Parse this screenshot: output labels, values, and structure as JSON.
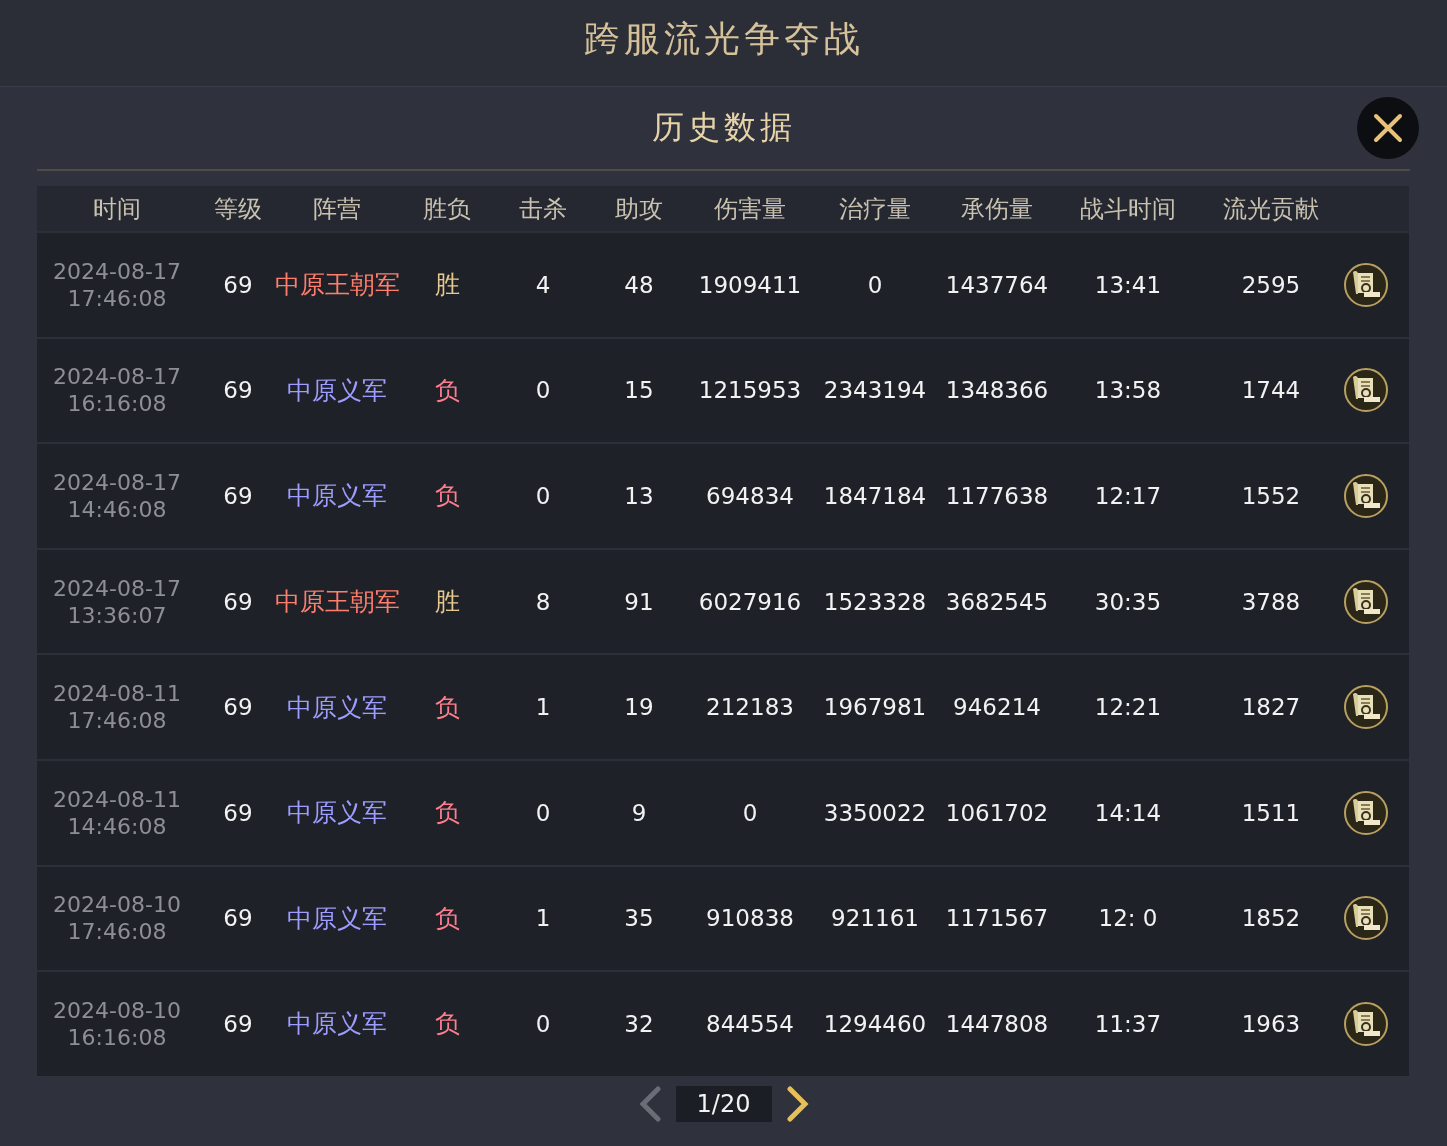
{
  "window": {
    "title": "跨服流光争夺战"
  },
  "panel": {
    "title": "历史数据"
  },
  "table": {
    "columns": [
      "时间",
      "等级",
      "阵营",
      "胜负",
      "击杀",
      "助攻",
      "伤害量",
      "治疗量",
      "承伤量",
      "战斗时间",
      "流光贡献"
    ],
    "rows": [
      {
        "date": "2024-08-17",
        "time": "17:46:08",
        "level": "69",
        "faction": {
          "text": "中原王朝军",
          "color": "#ff7e6b"
        },
        "result": {
          "text": "胜",
          "color": "#e6c98e"
        },
        "kills": "4",
        "assists": "48",
        "damage": "1909411",
        "healing": "0",
        "taken": "1437764",
        "duration": "13:41",
        "contribution": "2595"
      },
      {
        "date": "2024-08-17",
        "time": "16:16:08",
        "level": "69",
        "faction": {
          "text": "中原义军",
          "color": "#9d9cff"
        },
        "result": {
          "text": "负",
          "color": "#ff7e8e"
        },
        "kills": "0",
        "assists": "15",
        "damage": "1215953",
        "healing": "2343194",
        "taken": "1348366",
        "duration": "13:58",
        "contribution": "1744"
      },
      {
        "date": "2024-08-17",
        "time": "14:46:08",
        "level": "69",
        "faction": {
          "text": "中原义军",
          "color": "#9d9cff"
        },
        "result": {
          "text": "负",
          "color": "#ff7e8e"
        },
        "kills": "0",
        "assists": "13",
        "damage": "694834",
        "healing": "1847184",
        "taken": "1177638",
        "duration": "12:17",
        "contribution": "1552"
      },
      {
        "date": "2024-08-17",
        "time": "13:36:07",
        "level": "69",
        "faction": {
          "text": "中原王朝军",
          "color": "#ff7e6b"
        },
        "result": {
          "text": "胜",
          "color": "#e6c98e"
        },
        "kills": "8",
        "assists": "91",
        "damage": "6027916",
        "healing": "1523328",
        "taken": "3682545",
        "duration": "30:35",
        "contribution": "3788"
      },
      {
        "date": "2024-08-11",
        "time": "17:46:08",
        "level": "69",
        "faction": {
          "text": "中原义军",
          "color": "#9d9cff"
        },
        "result": {
          "text": "负",
          "color": "#ff7e8e"
        },
        "kills": "1",
        "assists": "19",
        "damage": "212183",
        "healing": "1967981",
        "taken": "946214",
        "duration": "12:21",
        "contribution": "1827"
      },
      {
        "date": "2024-08-11",
        "time": "14:46:08",
        "level": "69",
        "faction": {
          "text": "中原义军",
          "color": "#9d9cff"
        },
        "result": {
          "text": "负",
          "color": "#ff7e8e"
        },
        "kills": "0",
        "assists": "9",
        "damage": "0",
        "healing": "3350022",
        "taken": "1061702",
        "duration": "14:14",
        "contribution": "1511"
      },
      {
        "date": "2024-08-10",
        "time": "17:46:08",
        "level": "69",
        "faction": {
          "text": "中原义军",
          "color": "#9d9cff"
        },
        "result": {
          "text": "负",
          "color": "#ff7e8e"
        },
        "kills": "1",
        "assists": "35",
        "damage": "910838",
        "healing": "921161",
        "taken": "1171567",
        "duration": "12: 0",
        "contribution": "1852"
      },
      {
        "date": "2024-08-10",
        "time": "16:16:08",
        "level": "69",
        "faction": {
          "text": "中原义军",
          "color": "#9d9cff"
        },
        "result": {
          "text": "负",
          "color": "#ff7e8e"
        },
        "kills": "0",
        "assists": "32",
        "damage": "844554",
        "healing": "1294460",
        "taken": "1447808",
        "duration": "11:37",
        "contribution": "1963"
      }
    ]
  },
  "pagination": {
    "page": "1/20",
    "prev_enabled": false,
    "next_enabled": true
  }
}
